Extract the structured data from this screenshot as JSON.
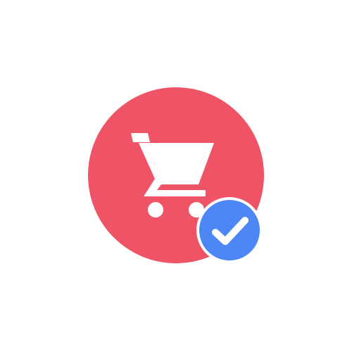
{
  "icon": {
    "name": "shopping-cart-verified",
    "badge_icon": "check-icon",
    "cart_icon": "shopping-cart-icon"
  },
  "colors": {
    "background": "#ffffff",
    "circle": "#ee5366",
    "cart": "#ffffff",
    "badge_fill": "#4d86f5",
    "badge_ring": "#ffffff",
    "badge_check": "#ffffff"
  }
}
